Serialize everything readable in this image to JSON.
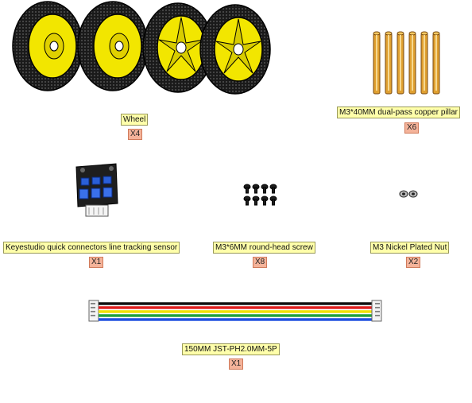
{
  "parts": [
    {
      "name": "Wheel",
      "qty": "X4"
    },
    {
      "name": "M3*40MM dual-pass copper pillar",
      "qty": "X6"
    },
    {
      "name": "Keyestudio quick connectors line tracking sensor",
      "qty": "X1"
    },
    {
      "name": "M3*6MM round-head screw",
      "qty": "X8"
    },
    {
      "name": "M3 Nickel Plated Nut",
      "qty": "X2"
    },
    {
      "name": "150MM JST-PH2.0MM-5P",
      "qty": "X1"
    }
  ],
  "colors": {
    "label_bg": "#ffffaa",
    "qty_bg": "#f4b39a",
    "tire": "#1a1a1a",
    "hub": "#f2e600",
    "copper": "#e0a030",
    "sensor_board": "#1e1e1e",
    "connector_blue": "#2a5fd8"
  },
  "cable_wire_colors": [
    "#111111",
    "#e02020",
    "#f0e000",
    "#20a040",
    "#2050e0"
  ]
}
